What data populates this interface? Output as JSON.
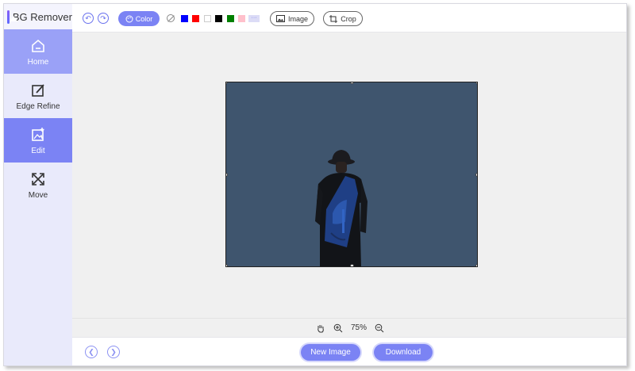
{
  "app": {
    "title": "BG Remover"
  },
  "sidebar": {
    "items": [
      {
        "label": "Home",
        "icon": "home-icon"
      },
      {
        "label": "Edge Refine",
        "icon": "edge-refine-icon"
      },
      {
        "label": "Edit",
        "icon": "edit-image-icon"
      },
      {
        "label": "Move",
        "icon": "move-icon"
      }
    ],
    "active_index": 2
  },
  "toolbar": {
    "color_label": "Color",
    "image_label": "Image",
    "crop_label": "Crop",
    "swatches": [
      "#0000ff",
      "#ff0000",
      "#ffffff",
      "#000000",
      "#008000",
      "#ffc0cb"
    ],
    "more_icon": "more-icon"
  },
  "canvas": {
    "background_color": "#3f556e"
  },
  "zoom": {
    "level": "75%"
  },
  "footer": {
    "new_image_label": "New Image",
    "download_label": "Download"
  },
  "colors": {
    "accent": "#7b83f4",
    "sidebar_bg": "#e9eafb"
  }
}
